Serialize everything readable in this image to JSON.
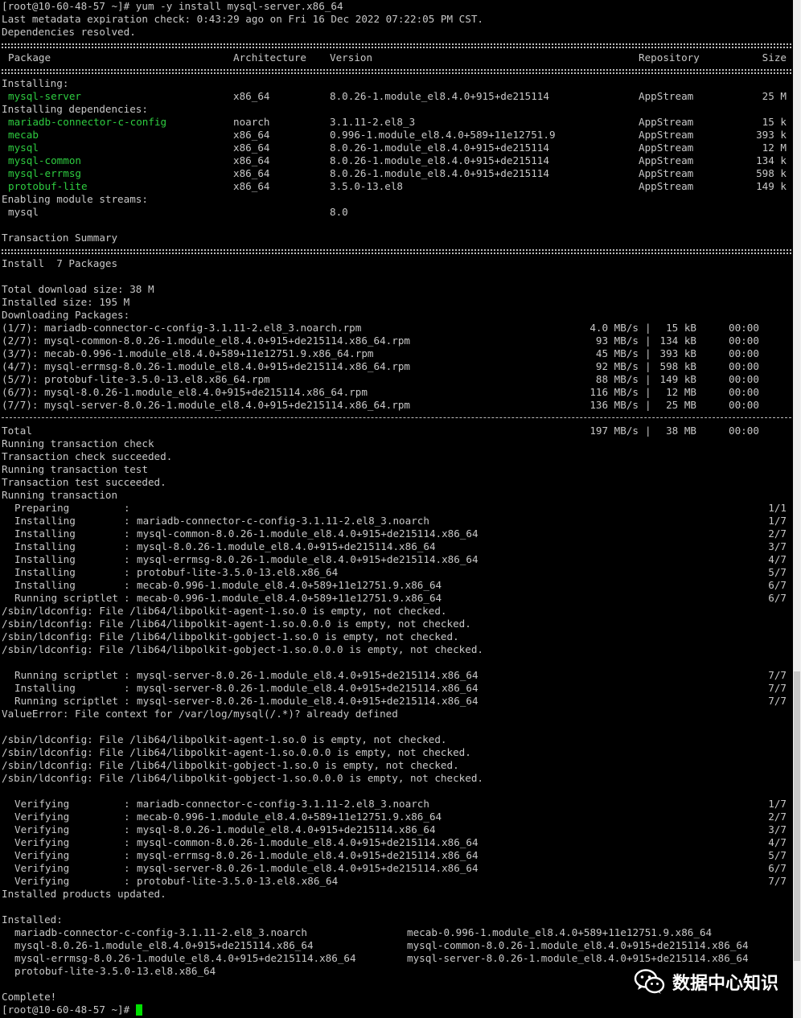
{
  "header": {
    "cmd": "[root@10-60-48-57 ~]# yum -y install mysql-server.x86_64",
    "meta": "Last metadata expiration check: 0:43:29 ago on Fri 16 Dec 2022 07:22:05 PM CST.",
    "resolved": "Dependencies resolved."
  },
  "table_headers": {
    "pkg": "Package",
    "arch": "Architecture",
    "ver": "Version",
    "repo": "Repository",
    "size": "Size"
  },
  "labels": {
    "installing": "Installing:",
    "deps": "Installing dependencies:",
    "streams": "Enabling module streams:",
    "summary": "Transaction Summary",
    "install_line": "Install  7 Packages",
    "dl_size": "Total download size: 38 M",
    "inst_size": "Installed size: 195 M",
    "downloading": "Downloading Packages:"
  },
  "install_rows": [
    {
      "name": "mysql-server",
      "arch": "x86_64",
      "ver": "8.0.26-1.module_el8.4.0+915+de215114",
      "repo": "AppStream",
      "size": "25 M"
    }
  ],
  "dep_rows": [
    {
      "name": "mariadb-connector-c-config",
      "arch": "noarch",
      "ver": "3.1.11-2.el8_3",
      "repo": "AppStream",
      "size": "15 k"
    },
    {
      "name": "mecab",
      "arch": "x86_64",
      "ver": "0.996-1.module_el8.4.0+589+11e12751.9",
      "repo": "AppStream",
      "size": "393 k"
    },
    {
      "name": "mysql",
      "arch": "x86_64",
      "ver": "8.0.26-1.module_el8.4.0+915+de215114",
      "repo": "AppStream",
      "size": "12 M"
    },
    {
      "name": "mysql-common",
      "arch": "x86_64",
      "ver": "8.0.26-1.module_el8.4.0+915+de215114",
      "repo": "AppStream",
      "size": "134 k"
    },
    {
      "name": "mysql-errmsg",
      "arch": "x86_64",
      "ver": "8.0.26-1.module_el8.4.0+915+de215114",
      "repo": "AppStream",
      "size": "598 k"
    },
    {
      "name": "protobuf-lite",
      "arch": "x86_64",
      "ver": "3.5.0-13.el8",
      "repo": "AppStream",
      "size": "149 k"
    }
  ],
  "stream_row": {
    "name": "mysql",
    "ver": "8.0"
  },
  "downloads": [
    {
      "file": "(1/7): mariadb-connector-c-config-3.1.11-2.el8_3.noarch.rpm",
      "speed": "4.0 MB/s",
      "size": " 15 kB",
      "time": "00:00"
    },
    {
      "file": "(2/7): mysql-common-8.0.26-1.module_el8.4.0+915+de215114.x86_64.rpm",
      "speed": "93 MB/s",
      "size": "134 kB",
      "time": "00:00"
    },
    {
      "file": "(3/7): mecab-0.996-1.module_el8.4.0+589+11e12751.9.x86_64.rpm",
      "speed": "45 MB/s",
      "size": "393 kB",
      "time": "00:00"
    },
    {
      "file": "(4/7): mysql-errmsg-8.0.26-1.module_el8.4.0+915+de215114.x86_64.rpm",
      "speed": "92 MB/s",
      "size": "598 kB",
      "time": "00:00"
    },
    {
      "file": "(5/7): protobuf-lite-3.5.0-13.el8.x86_64.rpm",
      "speed": "88 MB/s",
      "size": "149 kB",
      "time": "00:00"
    },
    {
      "file": "(6/7): mysql-8.0.26-1.module_el8.4.0+915+de215114.x86_64.rpm",
      "speed": "116 MB/s",
      "size": " 12 MB",
      "time": "00:00"
    },
    {
      "file": "(7/7): mysql-server-8.0.26-1.module_el8.4.0+915+de215114.x86_64.rpm",
      "speed": "136 MB/s",
      "size": " 25 MB",
      "time": "00:00"
    }
  ],
  "total_row": {
    "label": "Total",
    "speed": "197 MB/s",
    "size": " 38 MB",
    "time": "00:00"
  },
  "txn_lines": [
    "Running transaction check",
    "Transaction check succeeded.",
    "Running transaction test",
    "Transaction test succeeded.",
    "Running transaction"
  ],
  "steps1": [
    {
      "action": "Preparing",
      "target": "",
      "count": "1/1"
    },
    {
      "action": "Installing",
      "target": "mariadb-connector-c-config-3.1.11-2.el8_3.noarch",
      "count": "1/7"
    },
    {
      "action": "Installing",
      "target": "mysql-common-8.0.26-1.module_el8.4.0+915+de215114.x86_64",
      "count": "2/7"
    },
    {
      "action": "Installing",
      "target": "mysql-8.0.26-1.module_el8.4.0+915+de215114.x86_64",
      "count": "3/7"
    },
    {
      "action": "Installing",
      "target": "mysql-errmsg-8.0.26-1.module_el8.4.0+915+de215114.x86_64",
      "count": "4/7"
    },
    {
      "action": "Installing",
      "target": "protobuf-lite-3.5.0-13.el8.x86_64",
      "count": "5/7"
    },
    {
      "action": "Installing",
      "target": "mecab-0.996-1.module_el8.4.0+589+11e12751.9.x86_64",
      "count": "6/7"
    },
    {
      "action": "Running scriptlet",
      "target": "mecab-0.996-1.module_el8.4.0+589+11e12751.9.x86_64",
      "count": "6/7"
    }
  ],
  "ldconfig": [
    "/sbin/ldconfig: File /lib64/libpolkit-agent-1.so.0 is empty, not checked.",
    "/sbin/ldconfig: File /lib64/libpolkit-agent-1.so.0.0.0 is empty, not checked.",
    "/sbin/ldconfig: File /lib64/libpolkit-gobject-1.so.0 is empty, not checked.",
    "/sbin/ldconfig: File /lib64/libpolkit-gobject-1.so.0.0.0 is empty, not checked."
  ],
  "steps2": [
    {
      "action": "Running scriptlet",
      "target": "mysql-server-8.0.26-1.module_el8.4.0+915+de215114.x86_64",
      "count": "7/7"
    },
    {
      "action": "Installing",
      "target": "mysql-server-8.0.26-1.module_el8.4.0+915+de215114.x86_64",
      "count": "7/7"
    },
    {
      "action": "Running scriptlet",
      "target": "mysql-server-8.0.26-1.module_el8.4.0+915+de215114.x86_64",
      "count": "7/7"
    }
  ],
  "value_error": "ValueError: File context for /var/log/mysql(/.*)? already defined",
  "verify": [
    {
      "action": "Verifying",
      "target": "mariadb-connector-c-config-3.1.11-2.el8_3.noarch",
      "count": "1/7"
    },
    {
      "action": "Verifying",
      "target": "mecab-0.996-1.module_el8.4.0+589+11e12751.9.x86_64",
      "count": "2/7"
    },
    {
      "action": "Verifying",
      "target": "mysql-8.0.26-1.module_el8.4.0+915+de215114.x86_64",
      "count": "3/7"
    },
    {
      "action": "Verifying",
      "target": "mysql-common-8.0.26-1.module_el8.4.0+915+de215114.x86_64",
      "count": "4/7"
    },
    {
      "action": "Verifying",
      "target": "mysql-errmsg-8.0.26-1.module_el8.4.0+915+de215114.x86_64",
      "count": "5/7"
    },
    {
      "action": "Verifying",
      "target": "mysql-server-8.0.26-1.module_el8.4.0+915+de215114.x86_64",
      "count": "6/7"
    },
    {
      "action": "Verifying",
      "target": "protobuf-lite-3.5.0-13.el8.x86_64",
      "count": "7/7"
    }
  ],
  "products_updated": "Installed products updated.",
  "installed_label": "Installed:",
  "installed_grid": [
    [
      "mariadb-connector-c-config-3.1.11-2.el8_3.noarch",
      "mecab-0.996-1.module_el8.4.0+589+11e12751.9.x86_64"
    ],
    [
      "mysql-8.0.26-1.module_el8.4.0+915+de215114.x86_64",
      "mysql-common-8.0.26-1.module_el8.4.0+915+de215114.x86_64"
    ],
    [
      "mysql-errmsg-8.0.26-1.module_el8.4.0+915+de215114.x86_64",
      "mysql-server-8.0.26-1.module_el8.4.0+915+de215114.x86_64"
    ],
    [
      "protobuf-lite-3.5.0-13.el8.x86_64",
      ""
    ]
  ],
  "complete": "Complete!",
  "prompt": "[root@10-60-48-57 ~]# ",
  "watermark": {
    "text": "数据中心知识",
    "icon": "wechat-icon"
  }
}
